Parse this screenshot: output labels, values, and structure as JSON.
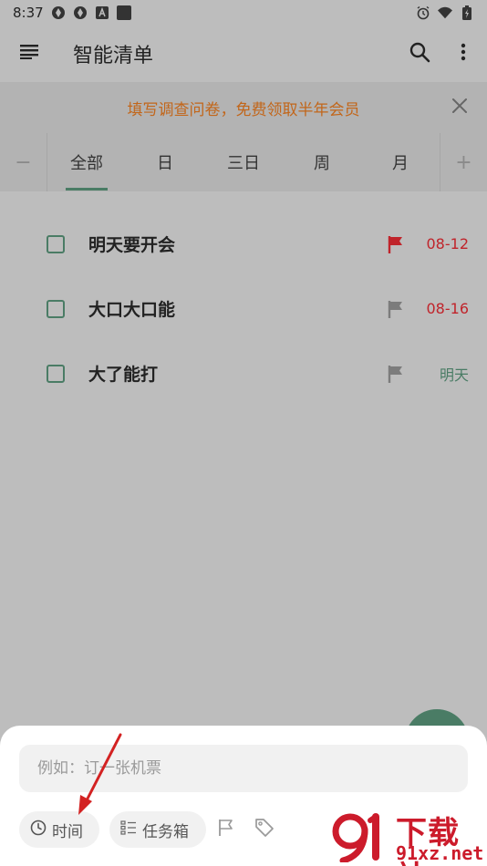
{
  "status_bar": {
    "time": "8:37",
    "left_icons": [
      "aperture-icon",
      "aperture-icon",
      "text-a-icon",
      "square-icon"
    ],
    "right_icons": [
      "alarm-icon",
      "wifi-icon",
      "battery-icon"
    ]
  },
  "app_bar": {
    "title": "智能清单",
    "menu_icon": "menu-icon",
    "search_icon": "search-icon",
    "more_icon": "more-vertical-icon"
  },
  "banner": {
    "text": "填写调查问卷，免费领取半年会员",
    "color": "#c2661a"
  },
  "tabs": {
    "left_symbol": "−",
    "right_symbol": "+",
    "items": [
      {
        "label": "全部",
        "active": true
      },
      {
        "label": "日",
        "active": false
      },
      {
        "label": "三日",
        "active": false
      },
      {
        "label": "周",
        "active": false
      },
      {
        "label": "月",
        "active": false
      }
    ]
  },
  "tasks": [
    {
      "title": "明天要开会",
      "flag_color": "#c0242b",
      "date": "08-12",
      "date_color": "#c0242b"
    },
    {
      "title": "大口大口能",
      "flag_color": "#7c7c7c",
      "date": "08-16",
      "date_color": "#c0242b"
    },
    {
      "title": "大了能打",
      "flag_color": "#7c7c7c",
      "date": "明天",
      "date_color": "#4a7c65"
    }
  ],
  "sheet": {
    "input_placeholder": "例如：订一张机票",
    "time_chip": "时间",
    "taskbox_chip": "任务箱"
  },
  "colors": {
    "accent": "#4a7c65",
    "overlay": "#bdbdbd",
    "arrow": "#d32222"
  },
  "watermark": {
    "title": "下载站",
    "domain": "91xz.net"
  }
}
